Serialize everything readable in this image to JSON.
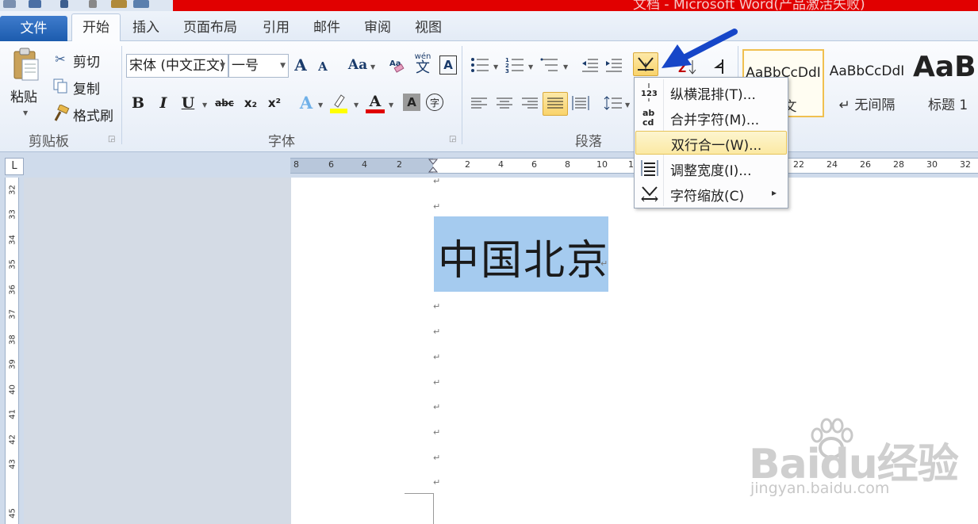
{
  "window": {
    "title": "文档 - Microsoft Word(产品激活失败)"
  },
  "tabs": [
    {
      "id": "file",
      "label": "文件"
    },
    {
      "id": "home",
      "label": "开始"
    },
    {
      "id": "insert",
      "label": "插入"
    },
    {
      "id": "layout",
      "label": "页面布局"
    },
    {
      "id": "references",
      "label": "引用"
    },
    {
      "id": "mailings",
      "label": "邮件"
    },
    {
      "id": "review",
      "label": "审阅"
    },
    {
      "id": "view",
      "label": "视图"
    }
  ],
  "clipboard": {
    "paste": "粘贴",
    "cut": "剪切",
    "copy": "复制",
    "format_painter": "格式刷",
    "group": "剪贴板"
  },
  "font": {
    "name": "宋体 (中文正文)",
    "size": "一号",
    "group": "字体",
    "bold": "B",
    "italic": "I",
    "underline": "U",
    "strike": "abc",
    "subscript": "x₂",
    "superscript": "x²",
    "grow": "A",
    "shrink": "A",
    "change_case": "Aa",
    "phonetic": "wén",
    "phonetic_char": "文",
    "border_char": "A",
    "shading_char": "A",
    "enclose_char": "字",
    "color_char": "A"
  },
  "paragraph": {
    "group": "段落"
  },
  "styles": [
    {
      "sample": "AaBbCcDdI",
      "name": "正文"
    },
    {
      "sample": "AaBbCcDdI",
      "name": "↵ 无间隔"
    },
    {
      "sample": "AaBb",
      "name": "标题 1"
    }
  ],
  "ruler": {
    "corner": "L",
    "horizontal_ticks": [
      "8",
      "6",
      "4",
      "2",
      "2",
      "4",
      "6",
      "8",
      "10",
      "12",
      "22",
      "24",
      "26",
      "28",
      "30",
      "32"
    ],
    "vertical_ticks": [
      "32",
      "33",
      "34",
      "35",
      "36",
      "37",
      "38",
      "39",
      "40",
      "41",
      "42",
      "43",
      "45"
    ]
  },
  "document": {
    "selected_text": "中国北京",
    "paragraph_mark": "↵"
  },
  "menu": {
    "items": [
      {
        "label": "纵横混排(T)...",
        "icon": "vertical-horizontal-icon",
        "glyph": "123"
      },
      {
        "label": "合并字符(M)...",
        "icon": "combine-chars-icon",
        "glyph": "ab cd"
      },
      {
        "label": "双行合一(W)...",
        "icon": "two-lines-in-one-icon",
        "glyph": ""
      },
      {
        "label": "调整宽度(I)...",
        "icon": "adjust-width-icon",
        "glyph": "≣"
      },
      {
        "label": "字符缩放(C)",
        "icon": "char-scale-icon",
        "glyph": "⟷"
      }
    ],
    "submenu_arrow": "▸"
  },
  "watermark": {
    "logo": "Baidu经验",
    "sub": "jingyan.baidu.com"
  },
  "colors": {
    "accent": "#1c5cae",
    "title_red": "#e10000",
    "selection": "#a5cbef",
    "highlight_menu": "#fbe9a4",
    "arrow_blue": "#1646c8"
  }
}
